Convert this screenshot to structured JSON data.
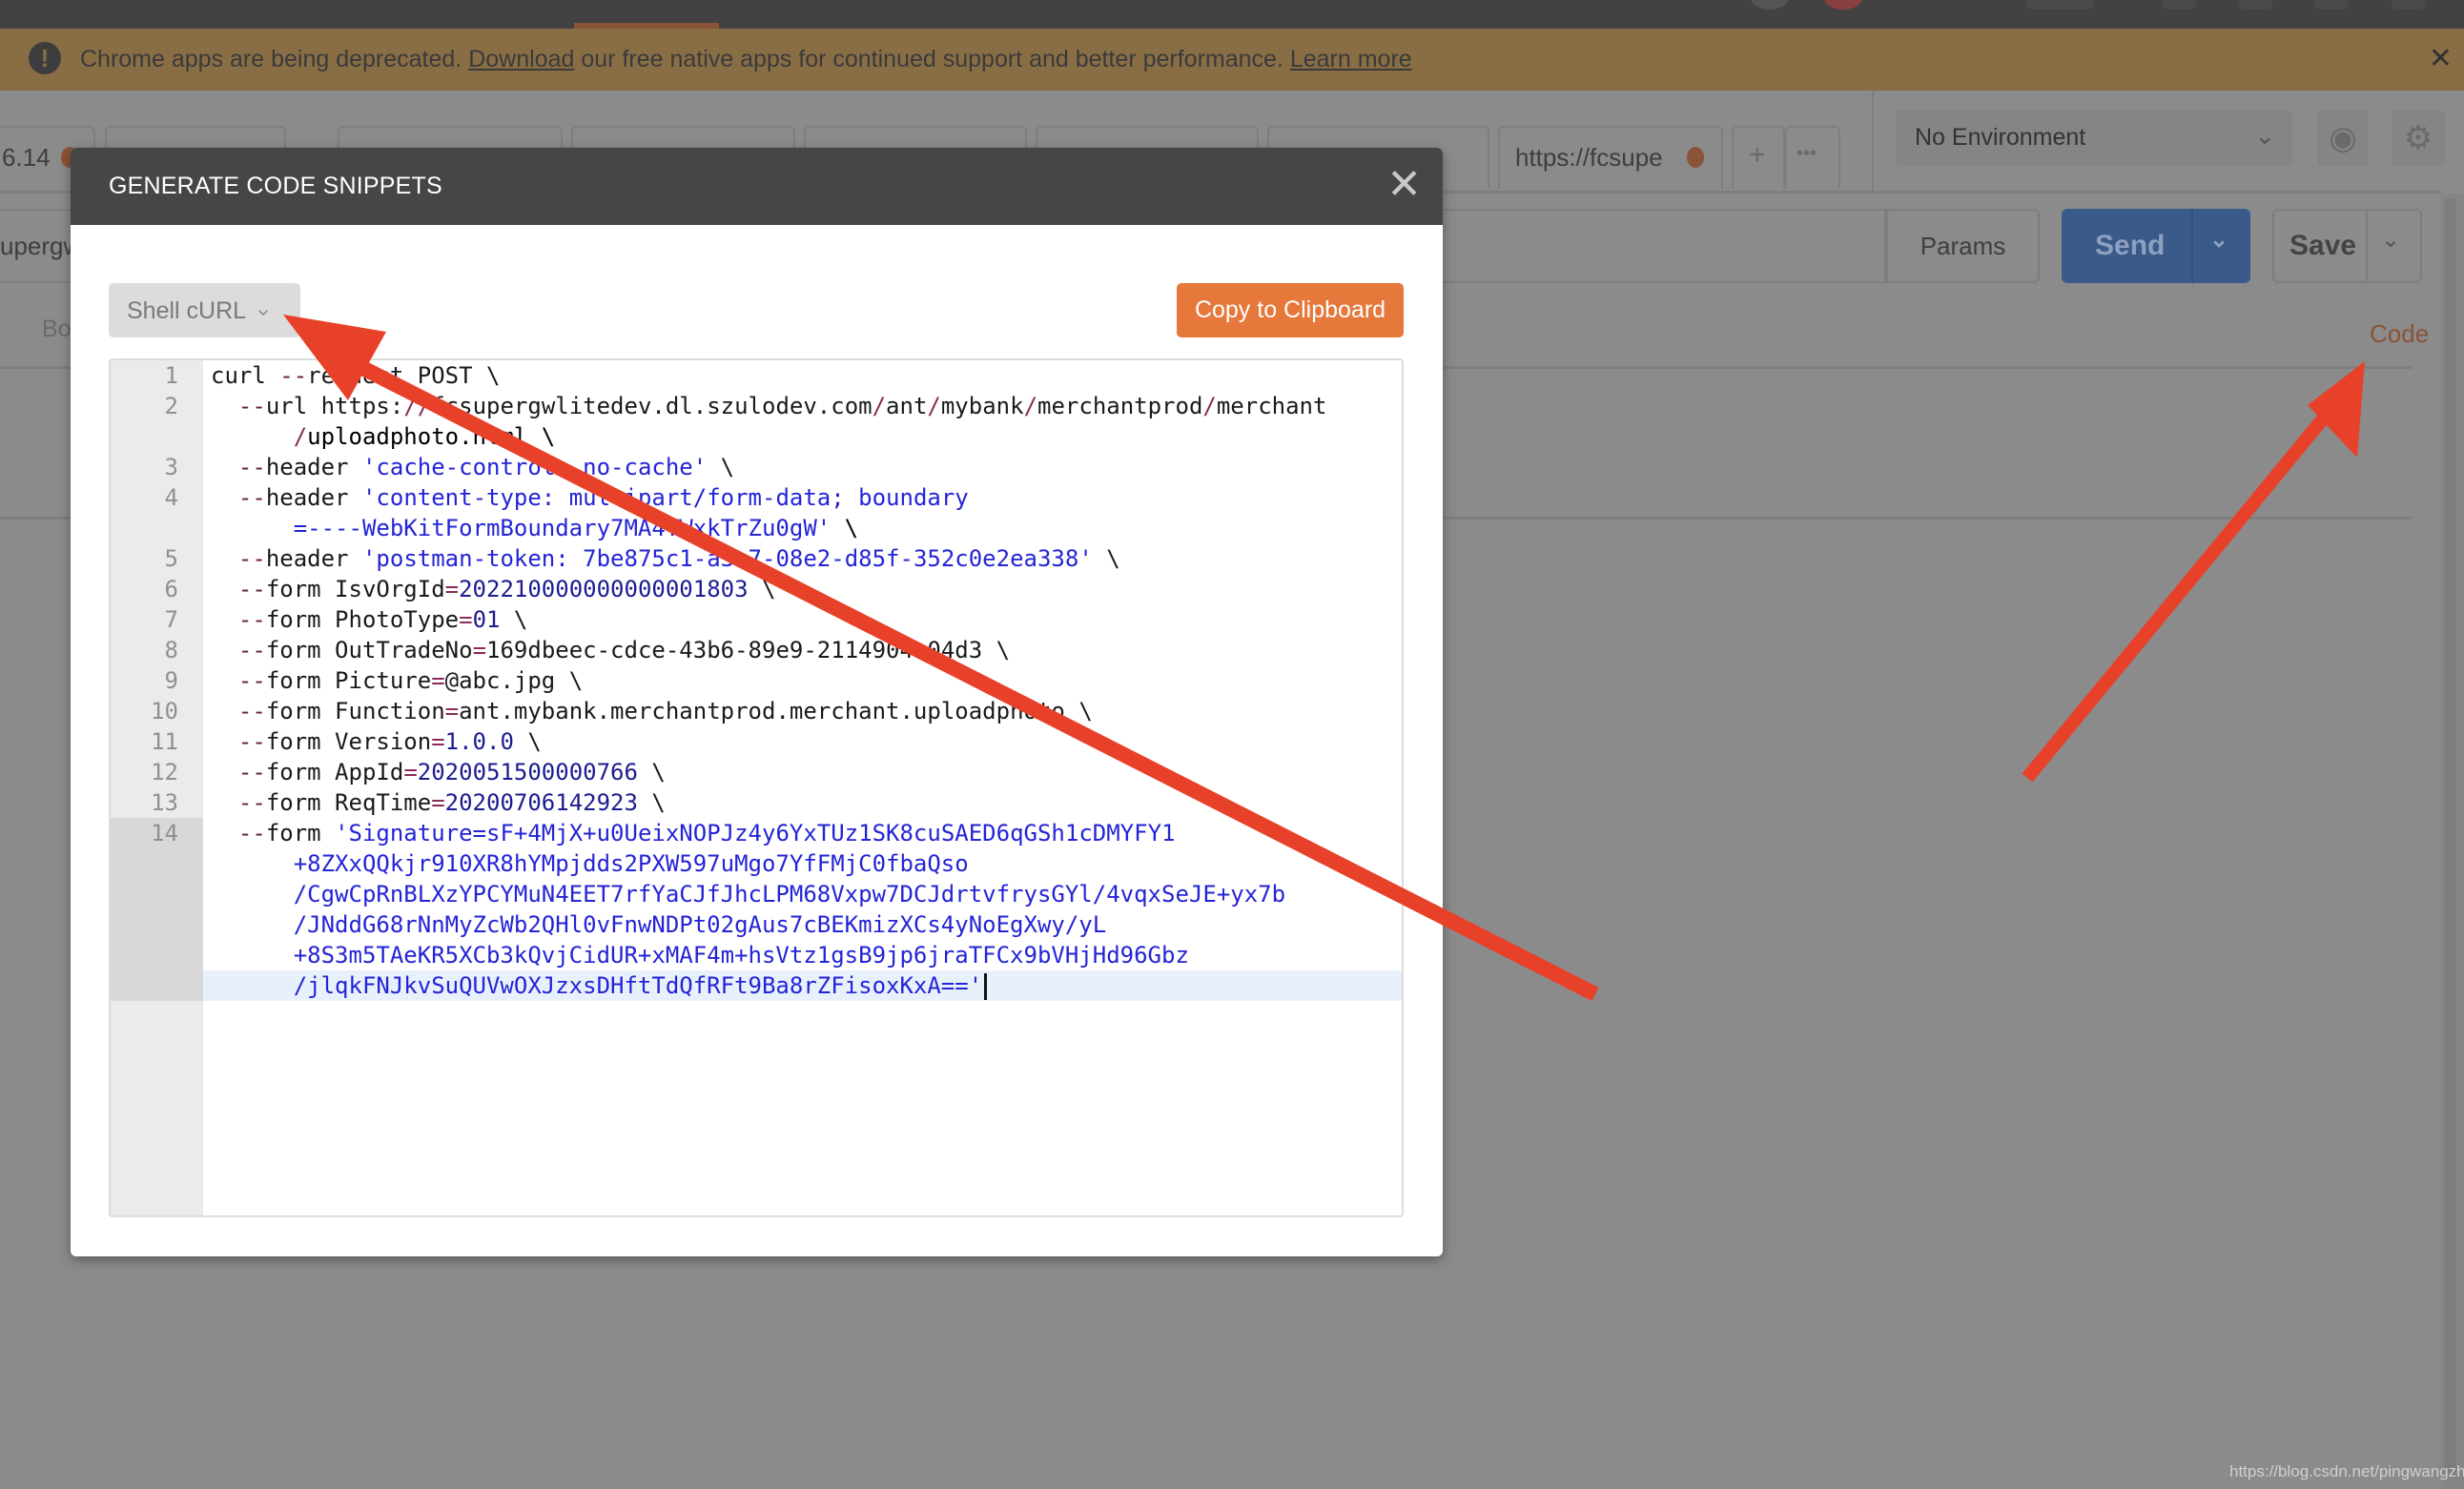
{
  "banner": {
    "message_before": "Chrome apps are being deprecated. ",
    "download_link": "Download",
    "message_after": " our free native apps for continued support and better performance. ",
    "learn_more_link": "Learn more",
    "close": "✕",
    "warn_icon": "!"
  },
  "tabs": [
    {
      "label": "6.14",
      "unsaved": true
    },
    {
      "label": ""
    },
    {
      "label": ""
    },
    {
      "label": ""
    },
    {
      "label": ""
    },
    {
      "label": ""
    },
    {
      "label": ""
    },
    {
      "label": "https://fcsupe",
      "unsaved": true
    }
  ],
  "tab_actions": {
    "add": "+",
    "more": "•••"
  },
  "environment": {
    "selected": "No Environment",
    "chevron": "⌄",
    "eye_icon": "◉",
    "gear_icon": "⚙"
  },
  "request": {
    "url_fragment": "upergw",
    "params_label": "Params",
    "send_label": "Send",
    "save_label": "Save",
    "chevron": "⌄",
    "body_tab_fragment": "Bo",
    "code_link": "Code"
  },
  "modal": {
    "title": "GENERATE CODE SNIPPETS",
    "close": "✕",
    "language": "Shell cURL",
    "language_chevron": "⌄",
    "copy_button": "Copy to Clipboard",
    "code_lines": [
      {
        "n": "1",
        "parts": [
          [
            "t",
            "curl "
          ],
          [
            "k",
            "--"
          ],
          [
            "t",
            "request POST \\"
          ]
        ]
      },
      {
        "n": "2",
        "parts": [
          [
            "t",
            "  "
          ],
          [
            "k",
            "--"
          ],
          [
            "t",
            "url https:"
          ],
          [
            "op",
            "//"
          ],
          [
            "t",
            "fcsupergwlitedev.dl.szulodev.com"
          ],
          [
            "op",
            "/"
          ],
          [
            "t",
            "ant"
          ],
          [
            "op",
            "/"
          ],
          [
            "t",
            "mybank"
          ],
          [
            "op",
            "/"
          ],
          [
            "t",
            "merchantprod"
          ],
          [
            "op",
            "/"
          ],
          [
            "t",
            "merchant"
          ]
        ],
        "cont": [
          [
            [
              "t",
              "      "
            ],
            [
              "op",
              "/"
            ],
            [
              "t",
              "uploadphoto.html \\"
            ]
          ]
        ]
      },
      {
        "n": "3",
        "parts": [
          [
            "t",
            "  "
          ],
          [
            "k",
            "--"
          ],
          [
            "t",
            "header "
          ],
          [
            "s",
            "'cache-control: no-cache'"
          ],
          [
            "t",
            " \\"
          ]
        ]
      },
      {
        "n": "4",
        "parts": [
          [
            "t",
            "  "
          ],
          [
            "k",
            "--"
          ],
          [
            "t",
            "header "
          ],
          [
            "s",
            "'content-type: multipart/form-data; boundary"
          ]
        ],
        "cont": [
          [
            [
              "s",
              "      =----WebKitFormBoundary7MA4YWxkTrZu0gW'"
            ],
            [
              "t",
              " \\"
            ]
          ]
        ]
      },
      {
        "n": "5",
        "parts": [
          [
            "t",
            "  "
          ],
          [
            "k",
            "--"
          ],
          [
            "t",
            "header "
          ],
          [
            "s",
            "'postman-token: 7be875c1-a3e7-08e2-d85f-352c0e2ea338'"
          ],
          [
            "t",
            " \\"
          ]
        ]
      },
      {
        "n": "6",
        "parts": [
          [
            "t",
            "  "
          ],
          [
            "k",
            "--"
          ],
          [
            "t",
            "form IsvOrgId"
          ],
          [
            "op",
            "="
          ],
          [
            "n",
            "202210000000000001803"
          ],
          [
            "t",
            " \\"
          ]
        ]
      },
      {
        "n": "7",
        "parts": [
          [
            "t",
            "  "
          ],
          [
            "k",
            "--"
          ],
          [
            "t",
            "form PhotoType"
          ],
          [
            "op",
            "="
          ],
          [
            "n",
            "01"
          ],
          [
            "t",
            " \\"
          ]
        ]
      },
      {
        "n": "8",
        "parts": [
          [
            "t",
            "  "
          ],
          [
            "k",
            "--"
          ],
          [
            "t",
            "form OutTradeNo"
          ],
          [
            "op",
            "="
          ],
          [
            "t",
            "169dbeec-cdce-43b6-89e9-2114904a04d3 \\"
          ]
        ]
      },
      {
        "n": "9",
        "parts": [
          [
            "t",
            "  "
          ],
          [
            "k",
            "--"
          ],
          [
            "t",
            "form Picture"
          ],
          [
            "op",
            "="
          ],
          [
            "t",
            "@abc.jpg \\"
          ]
        ]
      },
      {
        "n": "10",
        "parts": [
          [
            "t",
            "  "
          ],
          [
            "k",
            "--"
          ],
          [
            "t",
            "form Function"
          ],
          [
            "op",
            "="
          ],
          [
            "t",
            "ant.mybank.merchantprod.merchant.uploadphoto \\"
          ]
        ]
      },
      {
        "n": "11",
        "parts": [
          [
            "t",
            "  "
          ],
          [
            "k",
            "--"
          ],
          [
            "t",
            "form Version"
          ],
          [
            "op",
            "="
          ],
          [
            "n",
            "1.0.0"
          ],
          [
            "t",
            " \\"
          ]
        ]
      },
      {
        "n": "12",
        "parts": [
          [
            "t",
            "  "
          ],
          [
            "k",
            "--"
          ],
          [
            "t",
            "form AppId"
          ],
          [
            "op",
            "="
          ],
          [
            "n",
            "2020051500000766"
          ],
          [
            "t",
            " \\"
          ]
        ]
      },
      {
        "n": "13",
        "parts": [
          [
            "t",
            "  "
          ],
          [
            "k",
            "--"
          ],
          [
            "t",
            "form ReqTime"
          ],
          [
            "op",
            "="
          ],
          [
            "n",
            "20200706142923"
          ],
          [
            "t",
            " \\"
          ]
        ]
      },
      {
        "n": "14",
        "active": true,
        "parts": [
          [
            "t",
            "  "
          ],
          [
            "k",
            "--"
          ],
          [
            "t",
            "form "
          ],
          [
            "s",
            "'Signature=sF+4MjX+u0UeixNOPJz4y6YxTUz1SK8cuSAED6qGSh1cDMYFY1"
          ]
        ],
        "cont": [
          [
            [
              "s",
              "      +8ZXxQQkjr910XR8hYMpjdds2PXW597uMgo7YfFMjC0fbaQso"
            ]
          ],
          [
            [
              "s",
              "      /CgwCpRnBLXzYPCYMuN4EET7rfYaCJfJhcLPM68Vxpw7DCJdrtvfrysGYl/4vqxSeJE+yx7b"
            ]
          ],
          [
            [
              "s",
              "      /JNddG68rNnMyZcWb2QHl0vFnwNDPt02gAus7cBEKmizXCs4yNoEgXwy/yL"
            ]
          ],
          [
            [
              "s",
              "      +8S3m5TAeKR5XCb3kQvjCidUR+xMAF4m+hsVtz1gsB9jp6jraTFCx9bVHjHd96Gbz"
            ]
          ],
          [
            [
              "s",
              "      /jlqkFNJkvSuQUVwOXJzxsDHftTdQfRFt9Ba8rZFisoxKxA=='"
            ]
          ]
        ]
      }
    ]
  },
  "annotations": {
    "arrow_color": "#e8412a",
    "count": 2
  },
  "watermark": "https://blog.csdn.net/pingwangzhi",
  "colors": {
    "accent_orange": "#e5783a",
    "send_blue": "#3a5a8a",
    "banner": "#896e45",
    "modal_header": "#464646"
  }
}
